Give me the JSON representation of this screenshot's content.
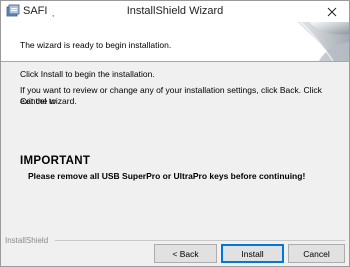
{
  "window": {
    "app_name": "SAFI",
    "app_name_mark": ",",
    "title": "InstallShield Wizard",
    "close_glyph": "✕"
  },
  "banner": {
    "text": "The wizard is ready to begin installation."
  },
  "content": {
    "line1": "Click Install to begin the installation.",
    "line2a": "If you want to review or change any of your installation settings, click Back. Click Cancel to",
    "line2b": "exit the wizard.",
    "important_heading": "IMPORTANT",
    "important_message": "Please remove all USB SuperPro or UltraPro keys before continuing!"
  },
  "footer": {
    "brand_label": "InstallShield",
    "buttons": {
      "back": "< Back",
      "install": "Install",
      "cancel": "Cancel"
    }
  },
  "colors": {
    "accent": "#0078d7",
    "window_bg": "#f0f0f0"
  }
}
